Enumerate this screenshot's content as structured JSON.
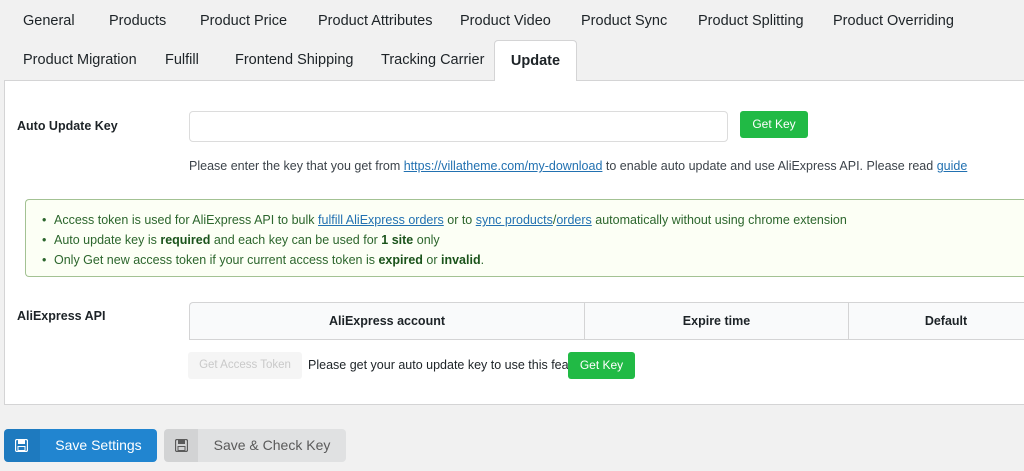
{
  "tabs": {
    "row1": [
      "General",
      "Products",
      "Product Price",
      "Product Attributes",
      "Product Video",
      "Product Sync",
      "Product Splitting",
      "Product Overriding"
    ],
    "row2": [
      "Product Migration",
      "Fulfill",
      "Frontend Shipping",
      "Tracking Carrier",
      "Update"
    ],
    "active": "Update"
  },
  "auto_update": {
    "label": "Auto Update Key",
    "input_value": "",
    "get_key_label": "Get Key",
    "help_prefix": "Please enter the key that you get from ",
    "help_link": "https://villatheme.com/my-download",
    "help_middle": " to enable auto update and use AliExpress API. Please read ",
    "help_guide": "guide"
  },
  "notice": {
    "line1": {
      "a": "Access token is used for AliExpress API to bulk ",
      "link1": "fulfill AliExpress orders",
      "b": " or to ",
      "link2": "sync products",
      "slash": "/",
      "link3": "orders",
      "c": " automatically without using chrome extension"
    },
    "line2": {
      "a": "Auto update key is ",
      "bold1": "required",
      "b": " and each key can be used for ",
      "bold2": "1 site",
      "c": " only"
    },
    "line3": {
      "a": "Only Get new access token if your current access token is ",
      "bold1": "expired",
      "b": " or ",
      "bold2": "invalid",
      "c": "."
    }
  },
  "aliexpress_api": {
    "label": "AliExpress API",
    "columns": [
      "AliExpress account",
      "Expire time",
      "Default"
    ],
    "get_access_token_label": "Get Access Token",
    "note": "Please get your auto update key to use this feature.",
    "get_key_label": "Get Key"
  },
  "footer": {
    "save_label": "Save Settings",
    "save_check_label": "Save & Check Key"
  },
  "colors": {
    "primary": "#2185d0",
    "green": "#21ba45",
    "notice_bg": "#fcfff5",
    "notice_text": "#2c662d"
  },
  "icons": {
    "save": "floppy-disk-icon"
  }
}
